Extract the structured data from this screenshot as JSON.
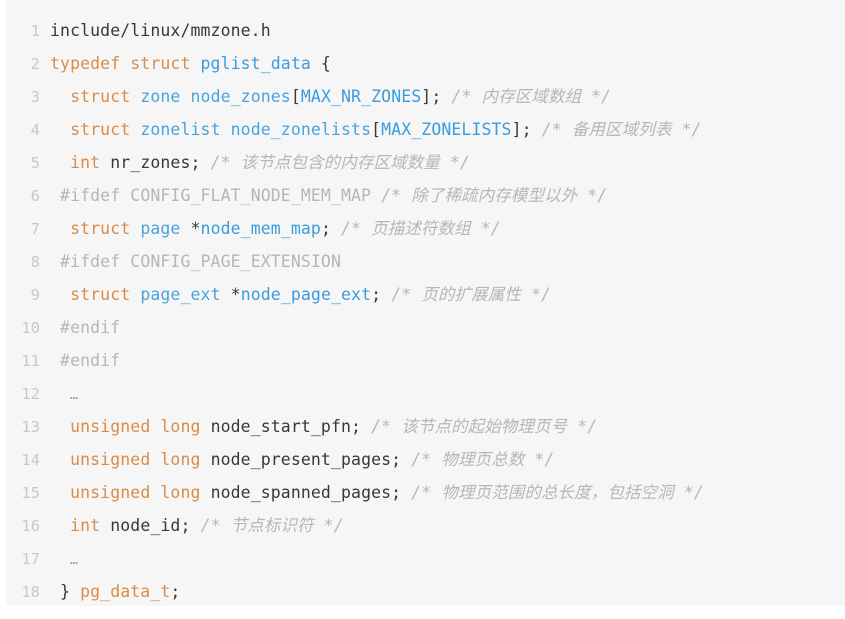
{
  "editor": {
    "background_color": "#f6f6f6",
    "page_background_color": "#ffffff",
    "gutter_color": "#c8c8c8",
    "default_text_color": "#383838",
    "colors": {
      "keyword": "#d98c4a",
      "type": "#4aa3df",
      "identifier": "#3b9bdd",
      "comment": "#b6b6b6",
      "preprocessor": "#b6b6b6",
      "punctuation": "#383838"
    },
    "total_lines": 18
  },
  "code": {
    "lines": [
      {
        "number": "1",
        "text": "include/linux/mmzone.h",
        "tokens": [
          {
            "t": "include/linux/mmzone.h",
            "c": "t-plain"
          }
        ]
      },
      {
        "number": "2",
        "text": "typedef struct pglist_data {",
        "tokens": [
          {
            "t": "typedef struct ",
            "c": "t-key"
          },
          {
            "t": "pglist_data",
            "c": "t-ident"
          },
          {
            "t": " {",
            "c": "t-punct"
          }
        ]
      },
      {
        "number": "3",
        "text": "  struct zone node_zones[MAX_NR_ZONES]; /* 内存区域数组 */",
        "tokens": [
          {
            "t": "  ",
            "c": "t-plain"
          },
          {
            "t": "struct ",
            "c": "t-key"
          },
          {
            "t": "zone node_zones",
            "c": "t-type"
          },
          {
            "t": "[",
            "c": "t-punct"
          },
          {
            "t": "MAX_NR_ZONES",
            "c": "t-const"
          },
          {
            "t": "]; ",
            "c": "t-punct"
          },
          {
            "t": "/* 内存区域数组 */",
            "c": "t-comment"
          }
        ]
      },
      {
        "number": "4",
        "text": "  struct zonelist node_zonelists[MAX_ZONELISTS]; /* 备用区域列表 */",
        "tokens": [
          {
            "t": "  ",
            "c": "t-plain"
          },
          {
            "t": "struct ",
            "c": "t-key"
          },
          {
            "t": "zonelist node_zonelists",
            "c": "t-type"
          },
          {
            "t": "[",
            "c": "t-punct"
          },
          {
            "t": "MAX_ZONELISTS",
            "c": "t-const"
          },
          {
            "t": "]; ",
            "c": "t-punct"
          },
          {
            "t": "/* 备用区域列表 */",
            "c": "t-comment"
          }
        ]
      },
      {
        "number": "5",
        "text": "  int nr_zones; /* 该节点包含的内存区域数量 */",
        "tokens": [
          {
            "t": "  ",
            "c": "t-plain"
          },
          {
            "t": "int",
            "c": "t-key"
          },
          {
            "t": " nr_zones; ",
            "c": "t-plain"
          },
          {
            "t": "/* 该节点包含的内存区域数量 */",
            "c": "t-comment"
          }
        ]
      },
      {
        "number": "6",
        "text": " #ifdef CONFIG_FLAT_NODE_MEM_MAP /* 除了稀疏内存模型以外 */",
        "tokens": [
          {
            "t": " ",
            "c": "t-plain"
          },
          {
            "t": "#ifdef CONFIG_FLAT_NODE_MEM_MAP ",
            "c": "t-pre"
          },
          {
            "t": "/* 除了稀疏内存模型以外 */",
            "c": "t-comment"
          }
        ]
      },
      {
        "number": "7",
        "text": "  struct page *node_mem_map; /* 页描述符数组 */",
        "tokens": [
          {
            "t": "  ",
            "c": "t-plain"
          },
          {
            "t": "struct ",
            "c": "t-key"
          },
          {
            "t": "page ",
            "c": "t-type"
          },
          {
            "t": "*",
            "c": "t-punct"
          },
          {
            "t": "node_mem_map",
            "c": "t-ident"
          },
          {
            "t": "; ",
            "c": "t-punct"
          },
          {
            "t": "/* 页描述符数组 */",
            "c": "t-comment"
          }
        ]
      },
      {
        "number": "8",
        "text": " #ifdef CONFIG_PAGE_EXTENSION",
        "tokens": [
          {
            "t": " ",
            "c": "t-plain"
          },
          {
            "t": "#ifdef CONFIG_PAGE_EXTENSION",
            "c": "t-pre"
          }
        ]
      },
      {
        "number": "9",
        "text": "  struct page_ext *node_page_ext; /* 页的扩展属性 */",
        "tokens": [
          {
            "t": "  ",
            "c": "t-plain"
          },
          {
            "t": "struct ",
            "c": "t-key"
          },
          {
            "t": "page_ext ",
            "c": "t-type"
          },
          {
            "t": "*",
            "c": "t-punct"
          },
          {
            "t": "node_page_ext",
            "c": "t-ident"
          },
          {
            "t": "; ",
            "c": "t-punct"
          },
          {
            "t": "/* 页的扩展属性 */",
            "c": "t-comment"
          }
        ]
      },
      {
        "number": "10",
        "text": " #endif",
        "tokens": [
          {
            "t": " ",
            "c": "t-plain"
          },
          {
            "t": "#endif",
            "c": "t-pre"
          }
        ]
      },
      {
        "number": "11",
        "text": " #endif",
        "tokens": [
          {
            "t": " ",
            "c": "t-plain"
          },
          {
            "t": "#endif",
            "c": "t-pre"
          }
        ]
      },
      {
        "number": "12",
        "text": "  …",
        "tokens": [
          {
            "t": "  ",
            "c": "t-plain"
          },
          {
            "t": "…",
            "c": "t-ell"
          }
        ]
      },
      {
        "number": "13",
        "text": "  unsigned long node_start_pfn; /* 该节点的起始物理页号 */",
        "tokens": [
          {
            "t": "  ",
            "c": "t-plain"
          },
          {
            "t": "unsigned long",
            "c": "t-key"
          },
          {
            "t": " node_start_pfn; ",
            "c": "t-plain"
          },
          {
            "t": "/* 该节点的起始物理页号 */",
            "c": "t-comment"
          }
        ]
      },
      {
        "number": "14",
        "text": "  unsigned long node_present_pages; /* 物理页总数 */",
        "tokens": [
          {
            "t": "  ",
            "c": "t-plain"
          },
          {
            "t": "unsigned long",
            "c": "t-key"
          },
          {
            "t": " node_present_pages; ",
            "c": "t-plain"
          },
          {
            "t": "/* 物理页总数 */",
            "c": "t-comment"
          }
        ]
      },
      {
        "number": "15",
        "text": "  unsigned long node_spanned_pages; /* 物理页范围的总长度，包括空洞 */",
        "tokens": [
          {
            "t": "  ",
            "c": "t-plain"
          },
          {
            "t": "unsigned long",
            "c": "t-key"
          },
          {
            "t": " node_spanned_pages; ",
            "c": "t-plain"
          },
          {
            "t": "/* 物理页范围的总长度，包括空洞 */",
            "c": "t-comment"
          }
        ]
      },
      {
        "number": "16",
        "text": "  int node_id; /* 节点标识符 */",
        "tokens": [
          {
            "t": "  ",
            "c": "t-plain"
          },
          {
            "t": "int",
            "c": "t-key"
          },
          {
            "t": " node_id; ",
            "c": "t-plain"
          },
          {
            "t": "/* 节点标识符 */",
            "c": "t-comment"
          }
        ]
      },
      {
        "number": "17",
        "text": "  …",
        "tokens": [
          {
            "t": "  ",
            "c": "t-plain"
          },
          {
            "t": "…",
            "c": "t-ell"
          }
        ]
      },
      {
        "number": "18",
        "text": " } pg_data_t;",
        "tokens": [
          {
            "t": " } ",
            "c": "t-punct"
          },
          {
            "t": "pg_data_t",
            "c": "t-key"
          },
          {
            "t": ";",
            "c": "t-punct"
          }
        ]
      }
    ]
  }
}
